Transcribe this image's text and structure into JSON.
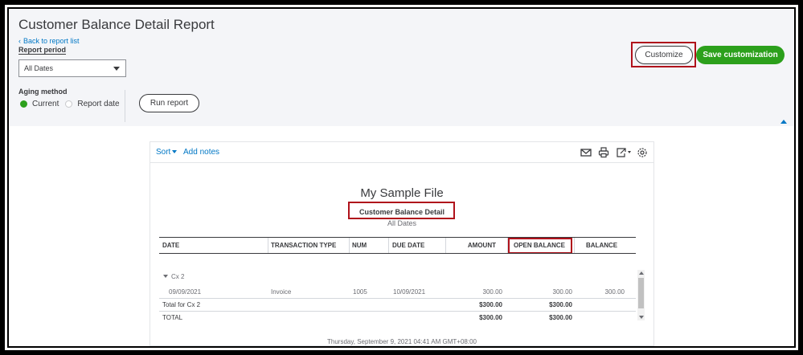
{
  "header": {
    "title": "Customer Balance Detail Report",
    "back_link": "Back to report list",
    "report_period_label": "Report period",
    "report_period_value": "All Dates",
    "aging_method_label": "Aging method",
    "aging_options": [
      "Current",
      "Report date"
    ],
    "aging_selected": "Current",
    "run_report": "Run report",
    "customize": "Customize",
    "save_customization": "Save customization"
  },
  "toolbar": {
    "sort": "Sort",
    "add_notes": "Add notes",
    "icons": [
      "email-icon",
      "print-icon",
      "export-icon",
      "settings-icon"
    ]
  },
  "report": {
    "company": "My Sample File",
    "name": "Customer Balance Detail",
    "date_range": "All Dates",
    "columns": [
      "DATE",
      "TRANSACTION TYPE",
      "NUM",
      "DUE DATE",
      "AMOUNT",
      "OPEN BALANCE",
      "BALANCE"
    ],
    "group": "Cx 2",
    "rows": [
      {
        "date": "09/09/2021",
        "type": "Invoice",
        "num": "1005",
        "due_date": "10/09/2021",
        "amount": "300.00",
        "open_balance": "300.00",
        "balance": "300.00"
      }
    ],
    "group_total": {
      "label": "Total for Cx 2",
      "amount": "$300.00",
      "open_balance": "$300.00"
    },
    "total": {
      "label": "TOTAL",
      "amount": "$300.00",
      "open_balance": "$300.00"
    },
    "footer": "Thursday, September 9, 2021   04:41 AM GMT+08:00"
  },
  "colors": {
    "accent": "#0077c5",
    "brand_green": "#2ca01c",
    "highlight": "#b0121b"
  }
}
